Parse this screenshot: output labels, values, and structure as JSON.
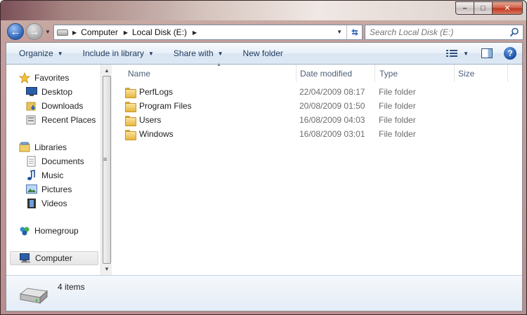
{
  "window": {
    "caption_buttons": {
      "minimize": "–",
      "maximize": "□",
      "close": "✕"
    }
  },
  "navigation": {
    "breadcrumbs": [
      "Computer",
      "Local Disk (E:)"
    ],
    "search_placeholder": "Search Local Disk (E:)"
  },
  "toolbar": {
    "organize": "Organize",
    "include_in_library": "Include in library",
    "share_with": "Share with",
    "new_folder": "New folder",
    "help": "?"
  },
  "sidebar": {
    "favorites": {
      "label": "Favorites",
      "items": [
        "Desktop",
        "Downloads",
        "Recent Places"
      ]
    },
    "libraries": {
      "label": "Libraries",
      "items": [
        "Documents",
        "Music",
        "Pictures",
        "Videos"
      ]
    },
    "homegroup": "Homegroup",
    "computer": "Computer"
  },
  "columns": {
    "name": "Name",
    "date_modified": "Date modified",
    "type": "Type",
    "size": "Size"
  },
  "files": [
    {
      "name": "PerfLogs",
      "date": "22/04/2009 08:17",
      "type": "File folder"
    },
    {
      "name": "Program Files",
      "date": "20/08/2009 01:50",
      "type": "File folder"
    },
    {
      "name": "Users",
      "date": "16/08/2009 04:03",
      "type": "File folder"
    },
    {
      "name": "Windows",
      "date": "16/08/2009 03:01",
      "type": "File folder"
    }
  ],
  "status": {
    "item_count": "4 items"
  },
  "colors": {
    "toolbar_text": "#1e395b",
    "column_header_text": "#4c607a",
    "secondary_text": "#6d6d6d",
    "folder_yellow": "#e6b740",
    "accent_blue": "#2a62b8"
  },
  "icons": {
    "favorites": "star-icon",
    "desktop": "desktop-icon",
    "downloads": "downloads-folder-icon",
    "recent_places": "recent-places-icon",
    "libraries": "libraries-icon",
    "documents": "documents-icon",
    "music": "music-note-icon",
    "pictures": "pictures-icon",
    "videos": "videos-icon",
    "homegroup": "homegroup-icon",
    "computer": "computer-icon",
    "drive": "hard-drive-icon"
  }
}
